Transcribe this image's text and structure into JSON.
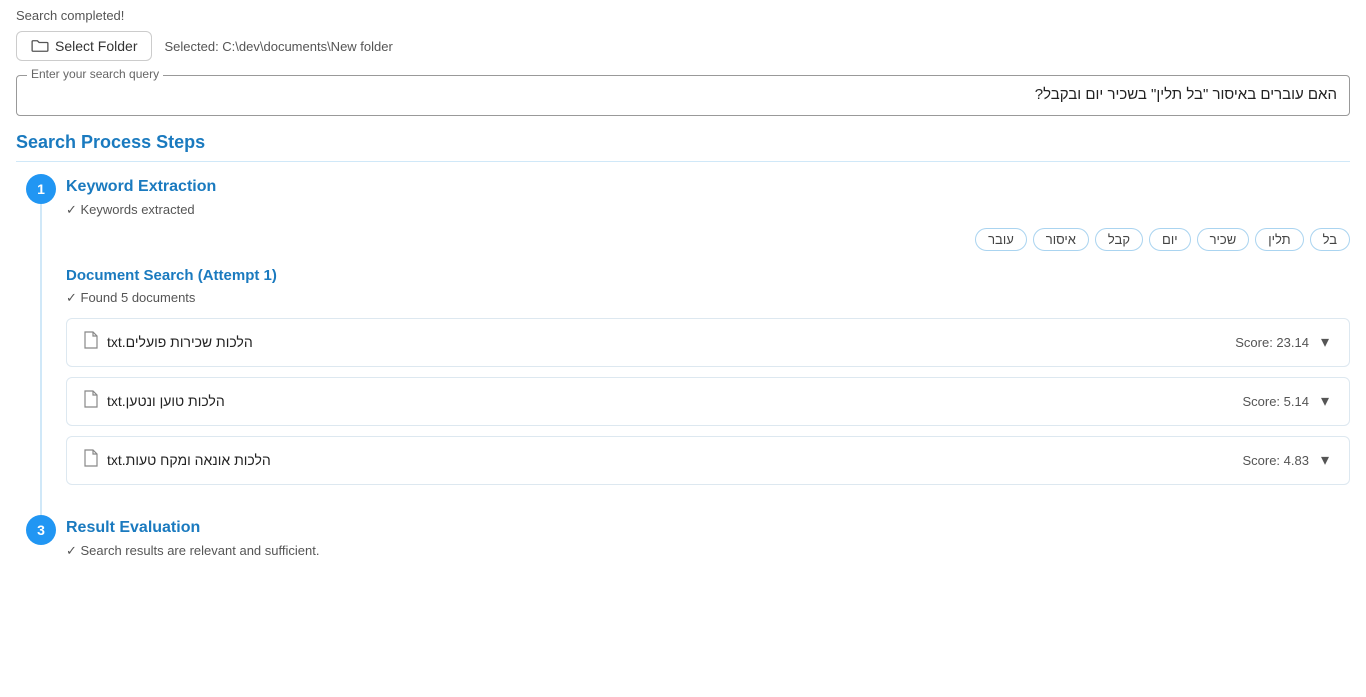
{
  "status": {
    "message": "Search completed!"
  },
  "folder": {
    "button_label": "Select Folder",
    "selected_text": "Selected: C:\\dev\\documents\\New folder"
  },
  "search_query": {
    "label": "Enter your search query",
    "value": "האם עוברים באיסור \"בל תלין\" בשכיר יום ובקבל?"
  },
  "section": {
    "title": "Search Process Steps"
  },
  "step1": {
    "number": "1",
    "heading": "Keyword Extraction",
    "status": "✓ Keywords extracted",
    "keywords": [
      "עובר",
      "איסור",
      "קבל",
      "יום",
      "שכיר",
      "תלין",
      "בל"
    ]
  },
  "sub_step": {
    "heading": "Document Search (Attempt 1)",
    "status": "✓ Found 5 documents"
  },
  "documents": [
    {
      "name": "הלכות שכירות פועלים.txt",
      "score_label": "Score: 23.14"
    },
    {
      "name": "הלכות טוען ונטען.txt",
      "score_label": "Score: 5.14"
    },
    {
      "name": "הלכות אונאה ומקח טעות.txt",
      "score_label": "Score: 4.83"
    }
  ],
  "step3": {
    "number": "3",
    "heading": "Result Evaluation",
    "status": "✓ Search results are relevant and sufficient."
  },
  "icons": {
    "folder": "📁",
    "file": "📄",
    "chevron_down": "▾"
  }
}
